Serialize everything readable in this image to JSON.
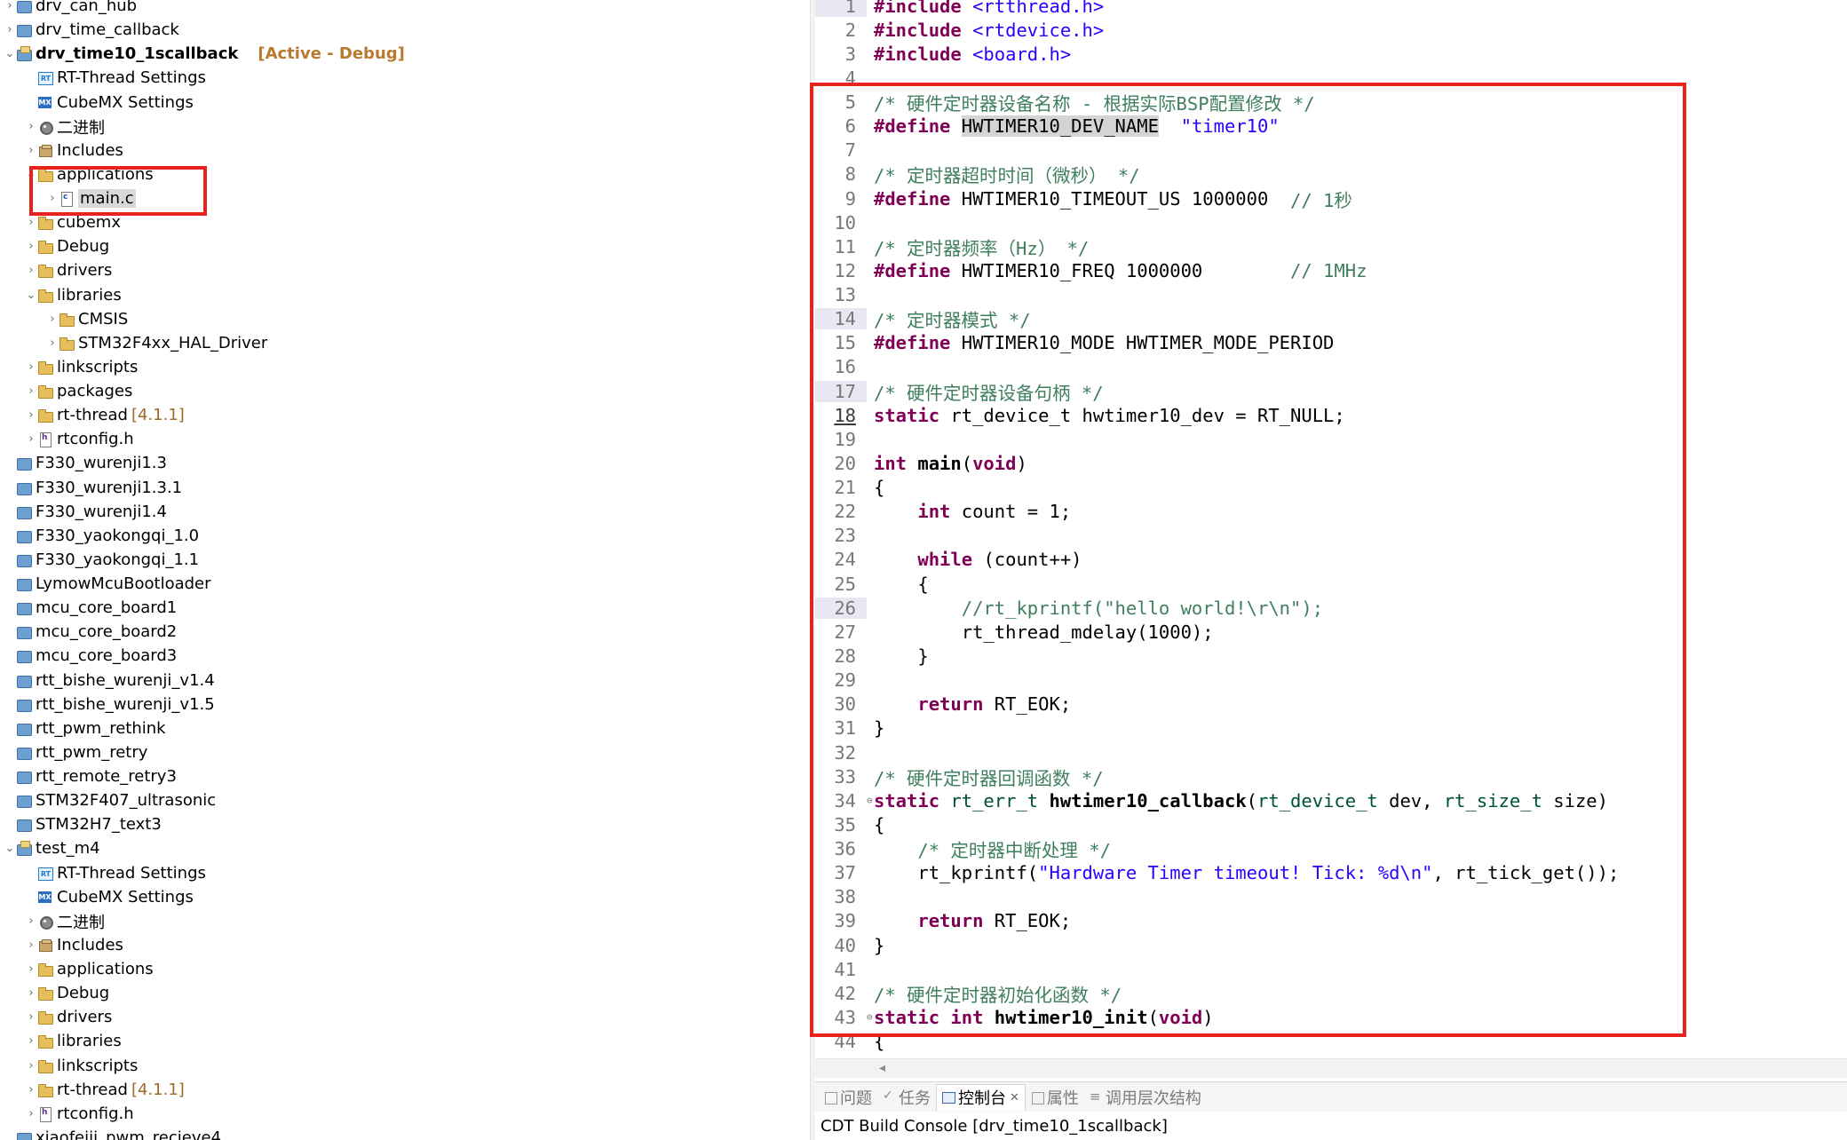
{
  "explorer": {
    "rows": [
      {
        "label": "drv_can_hub",
        "suffix": "",
        "icon": "project-icon",
        "arrow": "›"
      },
      {
        "label": "drv_time_callback",
        "suffix": "",
        "icon": "project-icon",
        "arrow": "›"
      },
      {
        "label": "drv_time10_1scallback",
        "suffix": "[Active - Debug]",
        "icon": "project-open-icon",
        "arrow": "⌄"
      },
      {
        "label": "RT-Thread Settings",
        "suffix": "",
        "icon": "rt-thread-icon",
        "arrow": ""
      },
      {
        "label": "CubeMX Settings",
        "suffix": "",
        "icon": "cubemx-icon",
        "arrow": ""
      },
      {
        "label": "二进制",
        "suffix": "",
        "icon": "binaries-icon",
        "arrow": "›"
      },
      {
        "label": "Includes",
        "suffix": "",
        "icon": "includes-icon",
        "arrow": "›"
      },
      {
        "label": "applications",
        "suffix": "",
        "icon": "folder-icon",
        "arrow": "⌄"
      },
      {
        "label": "main.c",
        "suffix": "",
        "icon": "c-file-icon",
        "arrow": "›"
      },
      {
        "label": "cubemx",
        "suffix": "",
        "icon": "folder-icon",
        "arrow": "›"
      },
      {
        "label": "Debug",
        "suffix": "",
        "icon": "folder-icon",
        "arrow": "›"
      },
      {
        "label": "drivers",
        "suffix": "",
        "icon": "folder-icon",
        "arrow": "›"
      },
      {
        "label": "libraries",
        "suffix": "",
        "icon": "folder-icon",
        "arrow": "⌄"
      },
      {
        "label": "CMSIS",
        "suffix": "",
        "icon": "folder-icon",
        "arrow": "›"
      },
      {
        "label": "STM32F4xx_HAL_Driver",
        "suffix": "",
        "icon": "folder-icon",
        "arrow": "›"
      },
      {
        "label": "linkscripts",
        "suffix": "",
        "icon": "folder-icon",
        "arrow": "›"
      },
      {
        "label": "packages",
        "suffix": "",
        "icon": "folder-icon",
        "arrow": "›"
      },
      {
        "label": "rt-thread",
        "suffix": "[4.1.1]",
        "icon": "folder-icon",
        "arrow": "›"
      },
      {
        "label": "rtconfig.h",
        "suffix": "",
        "icon": "h-file-icon",
        "arrow": "›"
      },
      {
        "label": "F330_wurenji1.3",
        "suffix": "",
        "icon": "project-icon",
        "arrow": ""
      },
      {
        "label": "F330_wurenji1.3.1",
        "suffix": "",
        "icon": "project-icon",
        "arrow": ""
      },
      {
        "label": "F330_wurenji1.4",
        "suffix": "",
        "icon": "project-icon",
        "arrow": ""
      },
      {
        "label": "F330_yaokongqi_1.0",
        "suffix": "",
        "icon": "project-icon",
        "arrow": ""
      },
      {
        "label": "F330_yaokongqi_1.1",
        "suffix": "",
        "icon": "project-icon",
        "arrow": ""
      },
      {
        "label": "LymowMcuBootloader",
        "suffix": "",
        "icon": "project-icon",
        "arrow": ""
      },
      {
        "label": "mcu_core_board1",
        "suffix": "",
        "icon": "project-icon",
        "arrow": ""
      },
      {
        "label": "mcu_core_board2",
        "suffix": "",
        "icon": "project-icon",
        "arrow": ""
      },
      {
        "label": "mcu_core_board3",
        "suffix": "",
        "icon": "project-icon",
        "arrow": ""
      },
      {
        "label": "rtt_bishe_wurenji_v1.4",
        "suffix": "",
        "icon": "project-icon",
        "arrow": ""
      },
      {
        "label": "rtt_bishe_wurenji_v1.5",
        "suffix": "",
        "icon": "project-icon",
        "arrow": ""
      },
      {
        "label": "rtt_pwm_rethink",
        "suffix": "",
        "icon": "project-icon",
        "arrow": ""
      },
      {
        "label": "rtt_pwm_retry",
        "suffix": "",
        "icon": "project-icon",
        "arrow": ""
      },
      {
        "label": "rtt_remote_retry3",
        "suffix": "",
        "icon": "project-icon",
        "arrow": ""
      },
      {
        "label": "STM32F407_ultrasonic",
        "suffix": "",
        "icon": "project-icon",
        "arrow": ""
      },
      {
        "label": "STM32H7_text3",
        "suffix": "",
        "icon": "project-icon",
        "arrow": ""
      },
      {
        "label": "test_m4",
        "suffix": "",
        "icon": "project-open-icon",
        "arrow": "⌄"
      },
      {
        "label": "RT-Thread Settings",
        "suffix": "",
        "icon": "rt-thread-icon",
        "arrow": ""
      },
      {
        "label": "CubeMX Settings",
        "suffix": "",
        "icon": "cubemx-icon",
        "arrow": ""
      },
      {
        "label": "二进制",
        "suffix": "",
        "icon": "binaries-icon",
        "arrow": "›"
      },
      {
        "label": "Includes",
        "suffix": "",
        "icon": "includes-icon",
        "arrow": "›"
      },
      {
        "label": "applications",
        "suffix": "",
        "icon": "folder-icon",
        "arrow": "›"
      },
      {
        "label": "Debug",
        "suffix": "",
        "icon": "folder-icon",
        "arrow": "›"
      },
      {
        "label": "drivers",
        "suffix": "",
        "icon": "folder-icon",
        "arrow": "›"
      },
      {
        "label": "libraries",
        "suffix": "",
        "icon": "folder-icon",
        "arrow": "›"
      },
      {
        "label": "linkscripts",
        "suffix": "",
        "icon": "folder-icon",
        "arrow": "›"
      },
      {
        "label": "rt-thread",
        "suffix": "[4.1.1]",
        "icon": "folder-icon",
        "arrow": "›"
      },
      {
        "label": "rtconfig.h",
        "suffix": "",
        "icon": "h-file-icon",
        "arrow": "›"
      },
      {
        "label": "xiaofeiji_pwm_recieve4",
        "suffix": "",
        "icon": "project-icon",
        "arrow": ""
      }
    ]
  },
  "editor": {
    "lines": [
      [
        [
          "kw",
          "#include "
        ],
        [
          "str",
          "<rtthread.h>"
        ]
      ],
      [
        [
          "kw",
          "#include "
        ],
        [
          "str",
          "<rtdevice.h>"
        ]
      ],
      [
        [
          "kw",
          "#include "
        ],
        [
          "str",
          "<board.h>"
        ]
      ],
      [],
      [
        [
          "cm",
          "/* 硬件定时器设备名称 - 根据实际BSP配置修改 */"
        ]
      ],
      [
        [
          "kw",
          "#define "
        ],
        [
          "hl",
          "HWTIMER10_DEV_NAME"
        ],
        [
          "",
          "  "
        ],
        [
          "str",
          "\"timer10\""
        ]
      ],
      [],
      [
        [
          "cm",
          "/* 定时器超时时间（微秒） */"
        ]
      ],
      [
        [
          "kw",
          "#define "
        ],
        [
          "",
          "HWTIMER10_TIMEOUT_US 1000000  "
        ],
        [
          "cm",
          "// 1秒"
        ]
      ],
      [],
      [
        [
          "cm",
          "/* 定时器频率（Hz） */"
        ]
      ],
      [
        [
          "kw",
          "#define "
        ],
        [
          "",
          "HWTIMER10_FREQ 1000000        "
        ],
        [
          "cm",
          "// 1MHz"
        ]
      ],
      [],
      [
        [
          "cm",
          "/* 定时器模式 */"
        ]
      ],
      [
        [
          "kw",
          "#define "
        ],
        [
          "",
          "HWTIMER10_MODE HWTIMER_MODE_PERIOD"
        ]
      ],
      [],
      [
        [
          "cm",
          "/* 硬件定时器设备句柄 */"
        ]
      ],
      [
        [
          "kw",
          "static "
        ],
        [
          "",
          "rt_device_t hwtimer10_dev = RT_NULL;"
        ]
      ],
      [],
      [
        [
          "kw",
          "int "
        ],
        [
          "fn",
          "main"
        ],
        [
          "",
          "("
        ],
        [
          "kw",
          "void"
        ],
        [
          "",
          ")"
        ]
      ],
      [
        [
          "",
          "{"
        ]
      ],
      [
        [
          "",
          "    "
        ],
        [
          "kw",
          "int "
        ],
        [
          "",
          "count = 1;"
        ]
      ],
      [],
      [
        [
          "",
          "    "
        ],
        [
          "kw",
          "while "
        ],
        [
          "",
          "(count++)"
        ]
      ],
      [
        [
          "",
          "    {"
        ]
      ],
      [
        [
          "",
          "        "
        ],
        [
          "cm",
          "//rt_kprintf(\"hello world!\\r\\n\");"
        ]
      ],
      [
        [
          "",
          "        rt_thread_mdelay(1000);"
        ]
      ],
      [
        [
          "",
          "    }"
        ]
      ],
      [],
      [
        [
          "",
          "    "
        ],
        [
          "kw",
          "return "
        ],
        [
          "",
          "RT_EOK;"
        ]
      ],
      [
        [
          "",
          "}"
        ]
      ],
      [],
      [
        [
          "cm",
          "/* 硬件定时器回调函数 */"
        ]
      ],
      [
        [
          "kw",
          "static "
        ],
        [
          "typ",
          "rt_err_t "
        ],
        [
          "fn",
          "hwtimer10_callback"
        ],
        [
          "",
          "("
        ],
        [
          "typ",
          "rt_device_t"
        ],
        [
          "",
          " dev, "
        ],
        [
          "typ",
          "rt_size_t"
        ],
        [
          "",
          " size)"
        ]
      ],
      [
        [
          "",
          "{"
        ]
      ],
      [
        [
          "",
          "    "
        ],
        [
          "cm",
          "/* 定时器中断处理 */"
        ]
      ],
      [
        [
          "",
          "    rt_kprintf("
        ],
        [
          "str",
          "\"Hardware Timer timeout! Tick: %d\\n\""
        ],
        [
          "",
          ", rt_tick_get());"
        ]
      ],
      [],
      [
        [
          "",
          "    "
        ],
        [
          "kw",
          "return "
        ],
        [
          "",
          "RT_EOK;"
        ]
      ],
      [
        [
          "",
          "}"
        ]
      ],
      [],
      [
        [
          "cm",
          "/* 硬件定时器初始化函数 */"
        ]
      ],
      [
        [
          "kw",
          "static int "
        ],
        [
          "fn",
          "hwtimer10_init"
        ],
        [
          "",
          "("
        ],
        [
          "kw",
          "void"
        ],
        [
          "",
          ")"
        ]
      ],
      [
        [
          "",
          "{"
        ]
      ]
    ],
    "marked_line_numbers": [
      1,
      14,
      17,
      26
    ],
    "fold_line_numbers": [
      34,
      43
    ]
  },
  "panel": {
    "tabs": [
      {
        "label": "问题",
        "icon": "problems-icon",
        "active": false
      },
      {
        "label": "任务",
        "icon": "tasks-icon",
        "active": false
      },
      {
        "label": "控制台",
        "icon": "console-icon",
        "active": true
      },
      {
        "label": "属性",
        "icon": "properties-icon",
        "active": false
      },
      {
        "label": "调用层次结构",
        "icon": "call-hierarchy-icon",
        "active": false
      }
    ],
    "console_title": "CDT Build Console [drv_time10_1scallback]"
  }
}
